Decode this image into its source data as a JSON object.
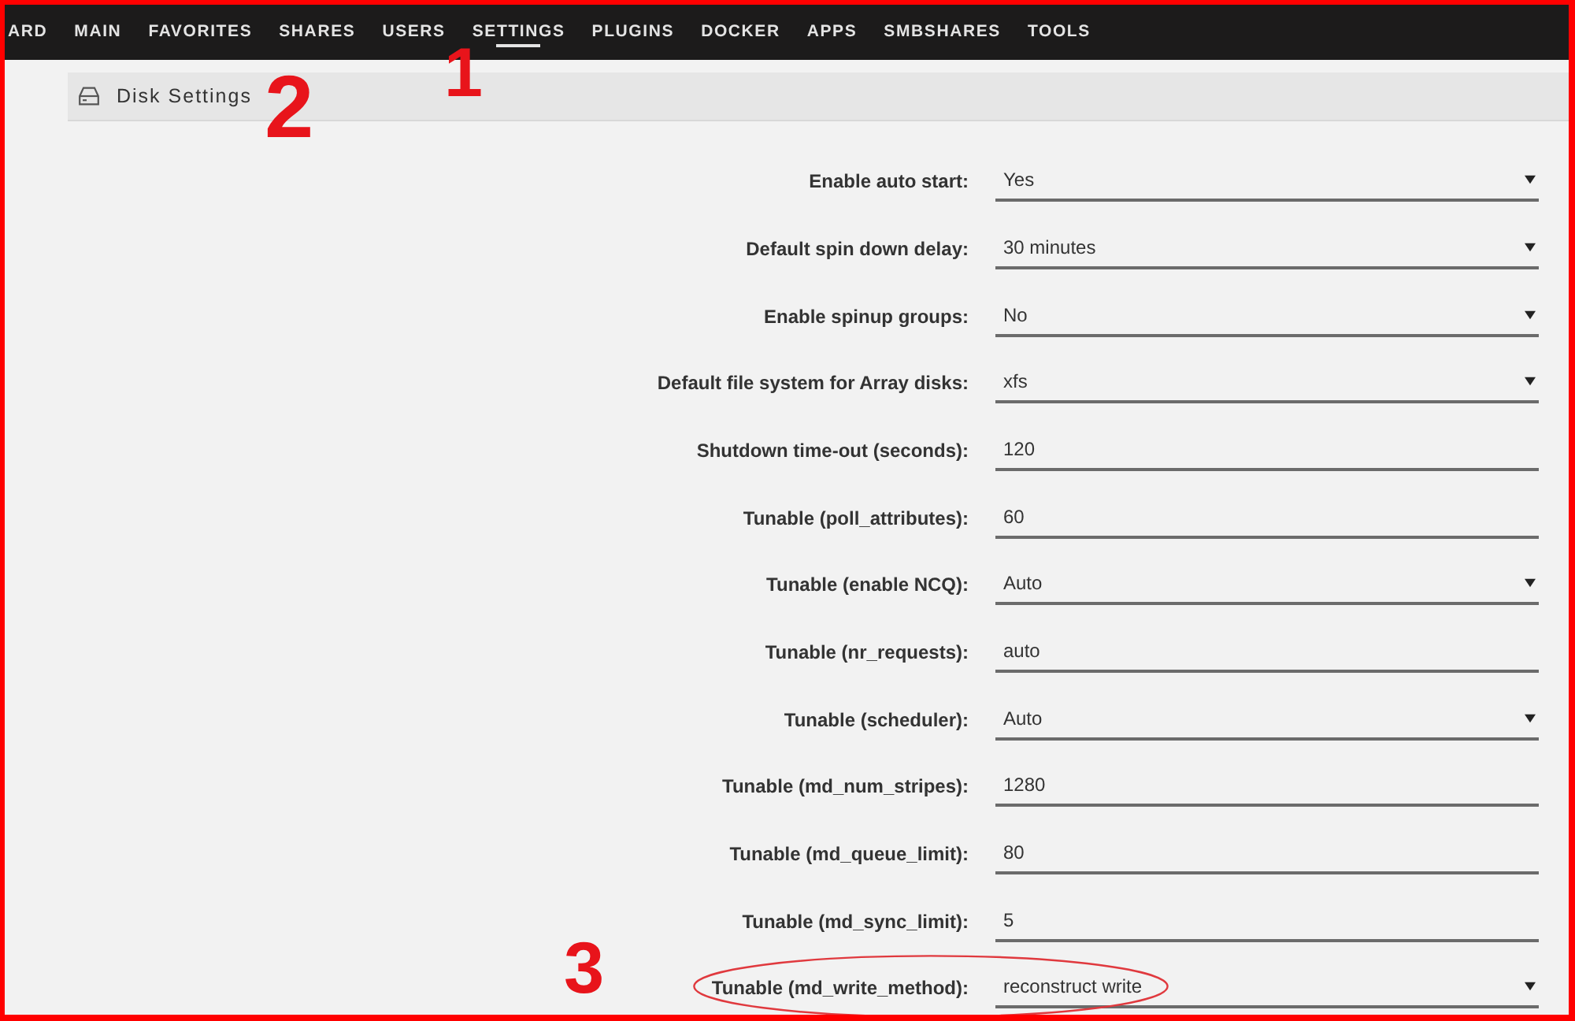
{
  "nav": [
    {
      "label": "ARD",
      "selected": false
    },
    {
      "label": "MAIN",
      "selected": false
    },
    {
      "label": "FAVORITES",
      "selected": false
    },
    {
      "label": "SHARES",
      "selected": false
    },
    {
      "label": "USERS",
      "selected": false
    },
    {
      "label": "SETTINGS",
      "selected": true,
      "annotation": "1"
    },
    {
      "label": "PLUGINS",
      "selected": false
    },
    {
      "label": "DOCKER",
      "selected": false
    },
    {
      "label": "APPS",
      "selected": false
    },
    {
      "label": "SMBSHARES",
      "selected": false
    },
    {
      "label": "TOOLS",
      "selected": false
    }
  ],
  "section": {
    "title": "Disk Settings",
    "annotation": "2"
  },
  "form": {
    "rows": [
      {
        "label": "Enable auto start:",
        "kind": "select",
        "value": "Yes",
        "circled": false
      },
      {
        "label": "Default spin down delay:",
        "kind": "select",
        "value": "30 minutes",
        "circled": false
      },
      {
        "label": "Enable spinup groups:",
        "kind": "select",
        "value": "No",
        "circled": false
      },
      {
        "label": "Default file system for Array disks:",
        "kind": "select",
        "value": "xfs",
        "circled": false
      },
      {
        "label": "Shutdown time-out (seconds):",
        "kind": "text",
        "value": "120",
        "circled": false
      },
      {
        "label": "Tunable (poll_attributes):",
        "kind": "text",
        "value": "60",
        "circled": false
      },
      {
        "label": "Tunable (enable NCQ):",
        "kind": "select",
        "value": "Auto",
        "circled": false
      },
      {
        "label": "Tunable (nr_requests):",
        "kind": "text",
        "value": "auto",
        "circled": false
      },
      {
        "label": "Tunable (scheduler):",
        "kind": "select",
        "value": "Auto",
        "circled": false
      },
      {
        "label": "Tunable (md_num_stripes):",
        "kind": "text",
        "value": "1280",
        "circled": false
      },
      {
        "label": "Tunable (md_queue_limit):",
        "kind": "text",
        "value": "80",
        "circled": false
      },
      {
        "label": "Tunable (md_sync_limit):",
        "kind": "text",
        "value": "5",
        "circled": false
      },
      {
        "label": "Tunable (md_write_method):",
        "kind": "select",
        "value": "reconstruct write",
        "circled": true,
        "annotation": "3"
      }
    ]
  }
}
